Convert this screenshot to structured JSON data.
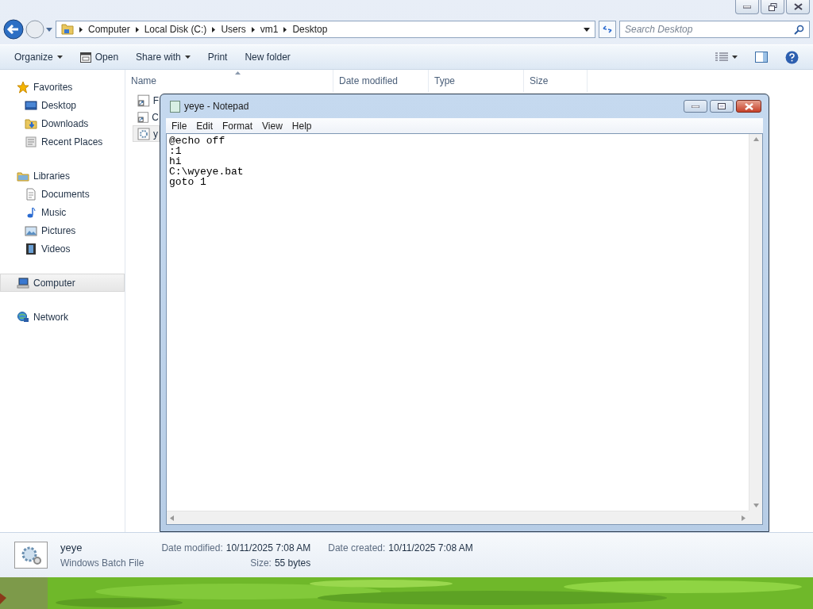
{
  "explorer": {
    "breadcrumbs": [
      "Computer",
      "Local Disk (C:)",
      "Users",
      "vm1",
      "Desktop"
    ],
    "search": {
      "placeholder": "Search Desktop"
    },
    "toolbar": [
      {
        "label": "Organize",
        "kind": "menu"
      },
      {
        "label": "Open",
        "kind": "open"
      },
      {
        "label": "Share with",
        "kind": "menu"
      },
      {
        "label": "Print",
        "kind": "plain"
      },
      {
        "label": "New folder",
        "kind": "plain"
      }
    ],
    "nav": [
      {
        "label": "Favorites",
        "kind": "star",
        "selected": false,
        "children": [
          {
            "label": "Desktop",
            "kind": "desktop",
            "selected": false
          },
          {
            "label": "Downloads",
            "kind": "downloads",
            "selected": false
          },
          {
            "label": "Recent Places",
            "kind": "recent",
            "selected": false
          }
        ]
      },
      {
        "label": "Libraries",
        "kind": "library",
        "selected": false,
        "children": [
          {
            "label": "Documents",
            "kind": "document",
            "selected": false
          },
          {
            "label": "Music",
            "kind": "music",
            "selected": false
          },
          {
            "label": "Pictures",
            "kind": "pictures",
            "selected": false
          },
          {
            "label": "Videos",
            "kind": "videos",
            "selected": false
          }
        ]
      },
      {
        "label": "Computer",
        "kind": "computer",
        "selected": true
      },
      {
        "label": "Network",
        "kind": "network",
        "selected": false
      }
    ],
    "columns": [
      "Name",
      "Date modified",
      "Type",
      "Size"
    ],
    "files": [
      {
        "name": "F",
        "kind": "shortcut",
        "selected": false
      },
      {
        "name": "C",
        "kind": "shortcut",
        "selected": false
      },
      {
        "name": "y",
        "kind": "batch",
        "selected": true
      }
    ],
    "details": {
      "name": "yeye",
      "type": "Windows Batch File",
      "fields": [
        {
          "label": "Date modified:",
          "value": "10/11/2025 7:08 AM"
        },
        {
          "label": "Size:",
          "value": "55 bytes"
        },
        {
          "label": "Date created:",
          "value": "10/11/2025 7:08 AM"
        }
      ]
    }
  },
  "notepad": {
    "title": "yeye - Notepad",
    "menu": [
      "File",
      "Edit",
      "Format",
      "View",
      "Help"
    ],
    "lines": [
      "@echo off",
      ":1",
      "hi",
      "C:\\wyeye.bat",
      "goto 1"
    ]
  }
}
